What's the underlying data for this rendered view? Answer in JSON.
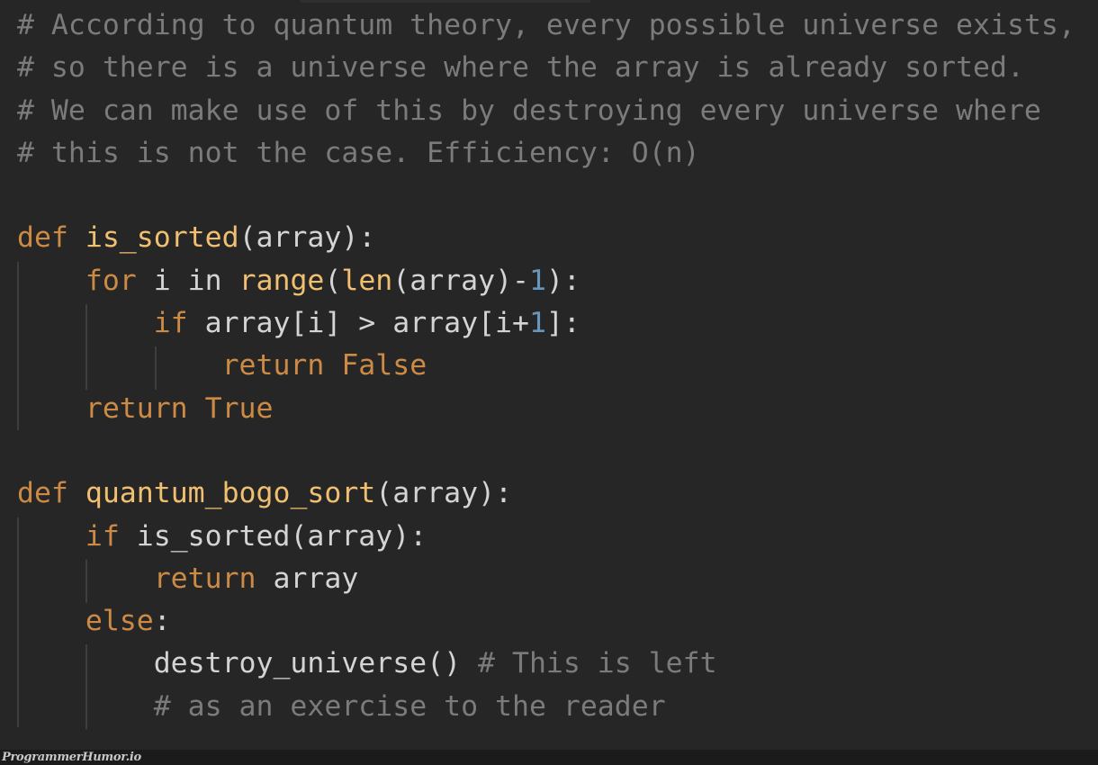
{
  "colors": {
    "background": "#262626",
    "comment": "#7b7b7b",
    "keyword": "#cc8a45",
    "function": "#f0c070",
    "number": "#6897bb",
    "text": "#d4d4d4"
  },
  "code": {
    "lines": [
      [
        {
          "t": "# According to quantum theory, every possible universe exists,",
          "k": "comment"
        }
      ],
      [
        {
          "t": "# so there is a universe where the array is already sorted.",
          "k": "comment"
        }
      ],
      [
        {
          "t": "# We can make use of this by destroying every universe where",
          "k": "comment"
        }
      ],
      [
        {
          "t": "# this is not the case. Efficiency: O(n)",
          "k": "comment"
        }
      ],
      [],
      [
        {
          "t": "def",
          "k": "kw"
        },
        {
          "t": " ",
          "k": "plain"
        },
        {
          "t": "is_sorted",
          "k": "fn"
        },
        {
          "t": "(array):",
          "k": "plain"
        }
      ],
      [
        {
          "t": "    ",
          "k": "plain"
        },
        {
          "t": "for",
          "k": "kw"
        },
        {
          "t": " i ",
          "k": "plain"
        },
        {
          "t": "in",
          "k": "plain"
        },
        {
          "t": " ",
          "k": "plain"
        },
        {
          "t": "range",
          "k": "fn"
        },
        {
          "t": "(",
          "k": "plain"
        },
        {
          "t": "len",
          "k": "fn"
        },
        {
          "t": "(array)-",
          "k": "plain"
        },
        {
          "t": "1",
          "k": "num"
        },
        {
          "t": "):",
          "k": "plain"
        }
      ],
      [
        {
          "t": "        ",
          "k": "plain"
        },
        {
          "t": "if",
          "k": "kw"
        },
        {
          "t": " array[i] > array[i+",
          "k": "plain"
        },
        {
          "t": "1",
          "k": "num"
        },
        {
          "t": "]:",
          "k": "plain"
        }
      ],
      [
        {
          "t": "            ",
          "k": "plain"
        },
        {
          "t": "return",
          "k": "kw"
        },
        {
          "t": " ",
          "k": "plain"
        },
        {
          "t": "False",
          "k": "kw"
        }
      ],
      [
        {
          "t": "    ",
          "k": "plain"
        },
        {
          "t": "return",
          "k": "kw"
        },
        {
          "t": " ",
          "k": "plain"
        },
        {
          "t": "True",
          "k": "kw"
        }
      ],
      [],
      [
        {
          "t": "def",
          "k": "kw"
        },
        {
          "t": " ",
          "k": "plain"
        },
        {
          "t": "quantum_bogo_sort",
          "k": "fn"
        },
        {
          "t": "(array):",
          "k": "plain"
        }
      ],
      [
        {
          "t": "    ",
          "k": "plain"
        },
        {
          "t": "if",
          "k": "kw"
        },
        {
          "t": " is_sorted(array):",
          "k": "plain"
        }
      ],
      [
        {
          "t": "        ",
          "k": "plain"
        },
        {
          "t": "return",
          "k": "kw"
        },
        {
          "t": " array",
          "k": "plain"
        }
      ],
      [
        {
          "t": "    ",
          "k": "plain"
        },
        {
          "t": "else",
          "k": "kw"
        },
        {
          "t": ":",
          "k": "plain"
        }
      ],
      [
        {
          "t": "        destroy_universe() ",
          "k": "plain"
        },
        {
          "t": "# This is left",
          "k": "comment"
        }
      ],
      [
        {
          "t": "        ",
          "k": "plain"
        },
        {
          "t": "# as an exercise to the reader",
          "k": "comment"
        }
      ]
    ]
  },
  "footer": {
    "watermark": "ProgrammerHumor.io"
  }
}
